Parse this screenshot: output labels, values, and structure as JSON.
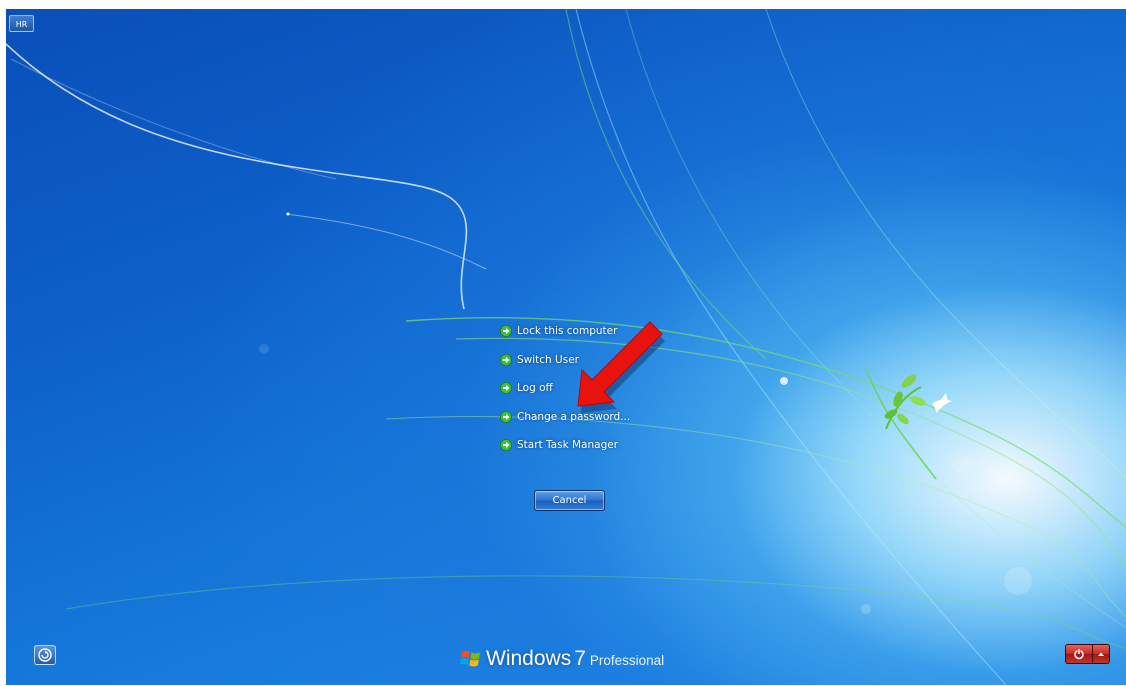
{
  "language_indicator": "HR",
  "menu": {
    "items": [
      {
        "label": "Lock this computer",
        "icon": "green-arrow-icon"
      },
      {
        "label": "Switch User",
        "icon": "green-arrow-icon"
      },
      {
        "label": "Log off",
        "icon": "green-arrow-icon"
      },
      {
        "label": "Change a password...",
        "icon": "green-arrow-icon"
      },
      {
        "label": "Start Task Manager",
        "icon": "green-arrow-icon"
      }
    ]
  },
  "cancel_button": "Cancel",
  "brand": {
    "name": "Windows",
    "version": "7",
    "edition": "Professional"
  },
  "icons": {
    "ease_of_access": "ease-of-access-icon",
    "shutdown": "power-icon",
    "shutdown_options": "chevron-up-icon",
    "annotation": "red-arrow-icon"
  },
  "colors": {
    "background_deep": "#0a4fb8",
    "background_light": "#9fe0ff",
    "menu_arrow": "#3fbf3a",
    "power_red": "#c42a22",
    "annotation_red": "#e8130f"
  }
}
